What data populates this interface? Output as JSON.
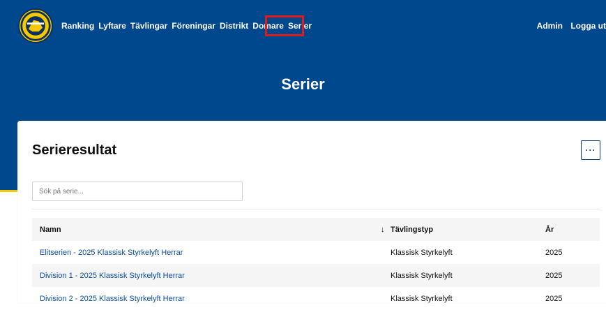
{
  "nav": {
    "items": [
      "Ranking",
      "Lyftare",
      "Tävlingar",
      "Föreningar",
      "Distrikt",
      "Domare",
      "Serier"
    ],
    "active": "Serier"
  },
  "user": {
    "admin": "Admin",
    "logout": "Logga ut"
  },
  "page": {
    "title": "Serier"
  },
  "card": {
    "title": "Serieresultat",
    "more_label": "···",
    "search_placeholder": "Sök på serie..."
  },
  "table": {
    "headers": {
      "name": "Namn",
      "sort_icon": "↓",
      "type": "Tävlingstyp",
      "year": "År"
    },
    "rows": [
      {
        "name": "Elitserien - 2025 Klassisk Styrkelyft Herrar",
        "type": "Klassisk Styrkelyft",
        "year": "2025"
      },
      {
        "name": "Division 1 - 2025 Klassisk Styrkelyft Herrar",
        "type": "Klassisk Styrkelyft",
        "year": "2025"
      },
      {
        "name": "Division 2 - 2025 Klassisk Styrkelyft Herrar",
        "type": "Klassisk Styrkelyft",
        "year": "2025"
      }
    ]
  },
  "colors": {
    "brand_blue": "#00488d",
    "accent_yellow": "#f7c900",
    "link": "#0b4ea2",
    "highlight": "#e01b1b"
  }
}
